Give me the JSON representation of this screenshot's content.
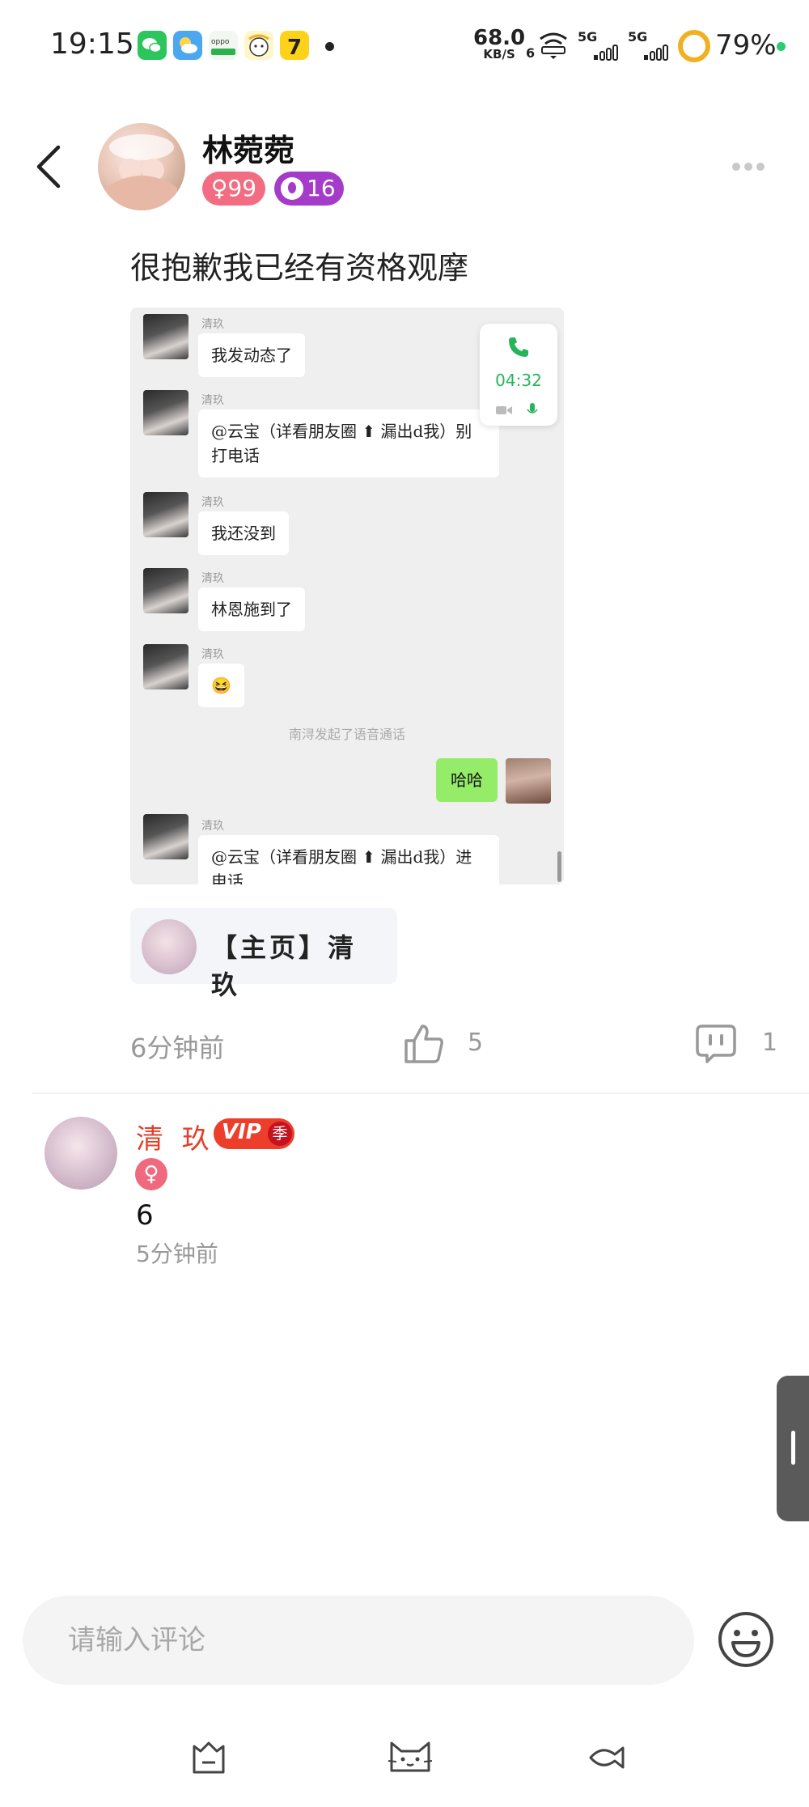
{
  "status_bar": {
    "time": "19:15",
    "net_speed": "68.0",
    "net_unit": "KB/S",
    "sim_index": "6",
    "signal1": "5G",
    "signal2": "5G",
    "battery": "79%",
    "apps": [
      "wechat-icon",
      "weather-icon",
      "oppo-icon",
      "cartoon-app-icon",
      "qimao-icon"
    ]
  },
  "header": {
    "name": "林菀菀",
    "gender_badge": "♀99",
    "level_badge": "16"
  },
  "post": {
    "text": "很抱歉我已经有资格观摩",
    "screenshot": {
      "call_card_time": "04:32",
      "messages": [
        {
          "sender": "清玖",
          "text": "我发动态了"
        },
        {
          "sender": "清玖",
          "text": "@云宝（详看朋友圈 ⬆ 漏出d我）别打电话"
        },
        {
          "sender": "清玖",
          "text": "我还没到"
        },
        {
          "sender": "清玖",
          "text": "林恩施到了"
        },
        {
          "sender": "清玖",
          "text": "😆"
        }
      ],
      "system_message": "南浔发起了语音通话",
      "my_message": "哈哈",
      "last_message": {
        "sender": "清玖",
        "text": "@云宝（详看朋友圈 ⬆ 漏出d我）进电话"
      }
    },
    "homepage_link": "【主页】清 玖",
    "time": "6分钟前",
    "likes": "5",
    "comments": "1"
  },
  "comment": {
    "name": "清 玖",
    "vip_label": "VIP",
    "vip_tier": "季",
    "gender": "♀",
    "text": "6",
    "time": "5分钟前"
  },
  "input": {
    "placeholder": "请输入评论"
  },
  "colors": {
    "accent_pink": "#f26d82",
    "accent_purple": "#a43cc9",
    "vip_red": "#ec3e2a",
    "chat_green": "#95ec69"
  }
}
